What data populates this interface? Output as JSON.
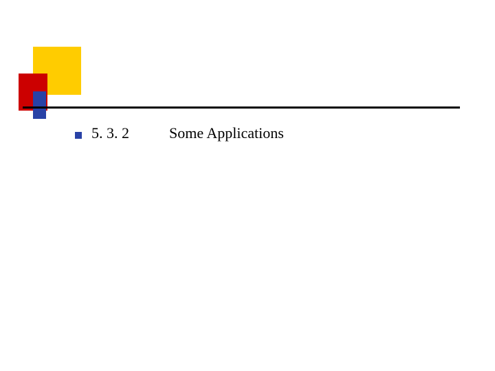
{
  "content": {
    "section_number": "5. 3. 2",
    "section_title": "Some Applications"
  },
  "colors": {
    "yellow": "#ffcc00",
    "red": "#cc0000",
    "blue": "#2942a6"
  }
}
